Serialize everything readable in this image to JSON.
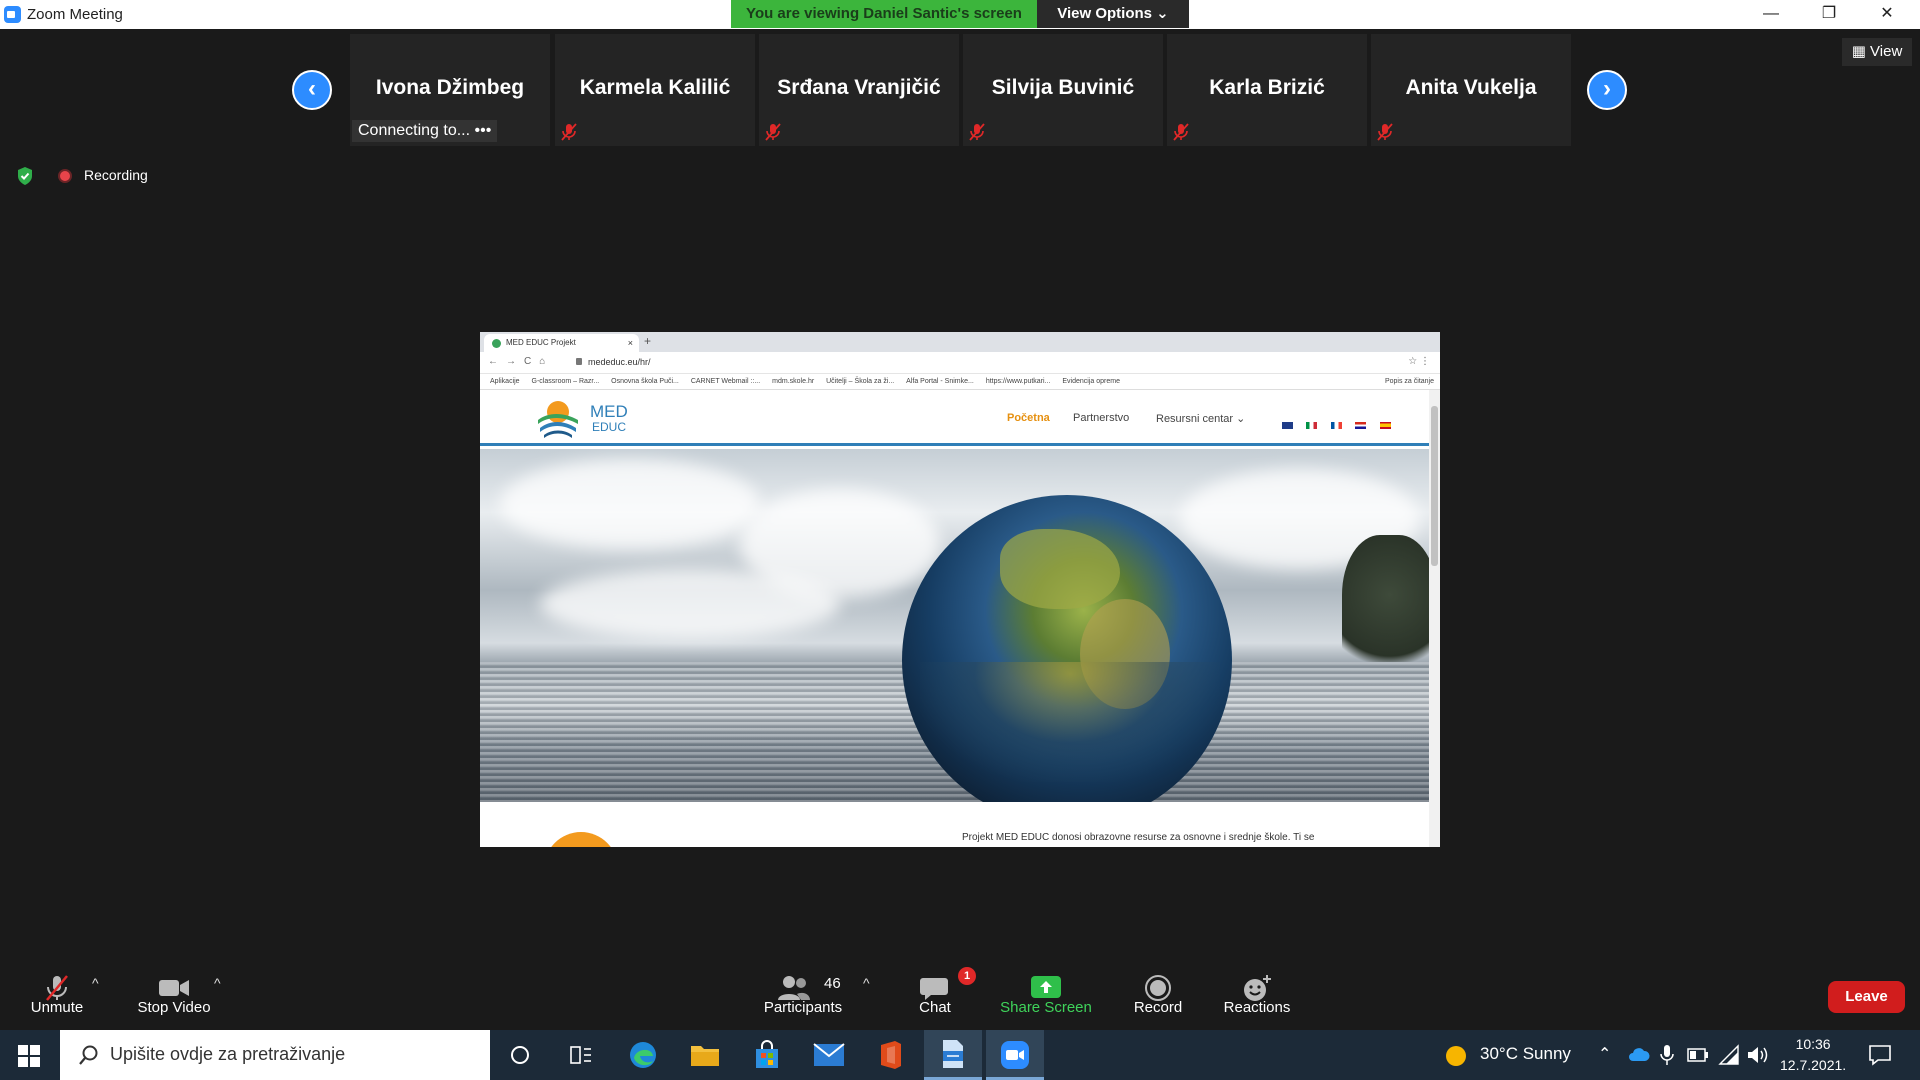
{
  "window": {
    "title": "Zoom Meeting",
    "banner": "You are viewing Daniel Santic's screen",
    "view_options": "View Options",
    "minimize": "—",
    "maximize": "❐",
    "close": "✕"
  },
  "strip": {
    "prev_icon": "‹",
    "next_icon": "›",
    "view_label": "View",
    "connecting": "Connecting to...",
    "participants": [
      {
        "name": "Ivona Džimbeg"
      },
      {
        "name": "Karmela Kalilić"
      },
      {
        "name": "Srđana Vranjičić"
      },
      {
        "name": "Silvija Buvinić"
      },
      {
        "name": "Karla Brizić"
      },
      {
        "name": "Anita Vukelja"
      }
    ]
  },
  "status": {
    "recording": "Recording"
  },
  "browser": {
    "tab_title": "MED EDUC Projekt",
    "tab_close": "×",
    "new_tab": "+",
    "url": "mededuc.eu/hr/",
    "nav_icons": "←→C⌂",
    "right_icons": "☆ ⋮",
    "bookmarks": [
      "Aplikacije",
      "G-classroom – Razr...",
      "Osnovna škola Puči...",
      "CARNET Webmail ::...",
      "mdm.skole.hr",
      "Učitelji – Škola za ži...",
      "Alfa Portal - Snimke...",
      "https://www.putkari...",
      "Evidencija opreme"
    ],
    "bookmark_right": "Popis za čitanje"
  },
  "site": {
    "logo_line1": "MED",
    "logo_line2": "EDUC",
    "menu": [
      {
        "label": "Početna",
        "active": true
      },
      {
        "label": "Partnerstvo",
        "active": false
      },
      {
        "label": "Resursni centar ⌄",
        "active": false
      }
    ],
    "text": "Projekt MED EDUC donosi obrazovne resurse za osnovne i srednje škole. Ti se",
    "accent": "#e69010",
    "brand": "#2f7fb8"
  },
  "toolbar": {
    "unmute": "Unmute",
    "stop_video": "Stop Video",
    "participants": "Participants",
    "participants_count": "46",
    "chat": "Chat",
    "chat_badge": "1",
    "share_screen": "Share Screen",
    "record": "Record",
    "reactions": "Reactions",
    "leave": "Leave",
    "caret": "^"
  },
  "taskbar": {
    "search_placeholder": "Upišite ovdje za pretraživanje",
    "weather": "30°C  Sunny",
    "time": "10:36",
    "date": "12.7.2021."
  }
}
